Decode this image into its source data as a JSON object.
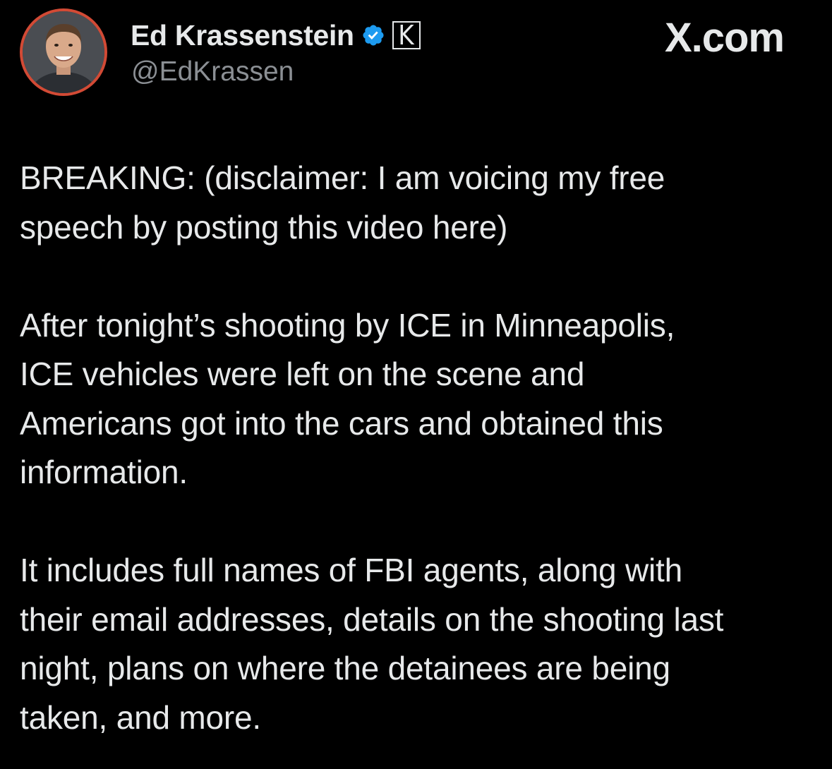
{
  "author": {
    "display_name": "Ed Krassenstein",
    "handle": "@EdKrassen",
    "verified": true,
    "affiliate_badge": "K",
    "avatar_icon": "profile-photo"
  },
  "brand": {
    "label": "X.com"
  },
  "post": {
    "paragraphs": [
      "BREAKING: (disclaimer: I am voicing my free\nspeech by posting this video here)",
      "After tonight’s shooting by ICE in Minneapolis,\nICE vehicles were left on the scene and\nAmericans got into the cars and obtained this\ninformation.",
      "It includes full names of FBI agents, along with\ntheir email addresses, details on the shooting last\nnight, plans on where the detainees are being\ntaken, and more."
    ]
  },
  "colors": {
    "background": "#000000",
    "text_primary": "#e7e9ea",
    "text_secondary": "#8b8f94",
    "verified_blue": "#1d9bf0",
    "avatar_ring": "#d24a35"
  }
}
